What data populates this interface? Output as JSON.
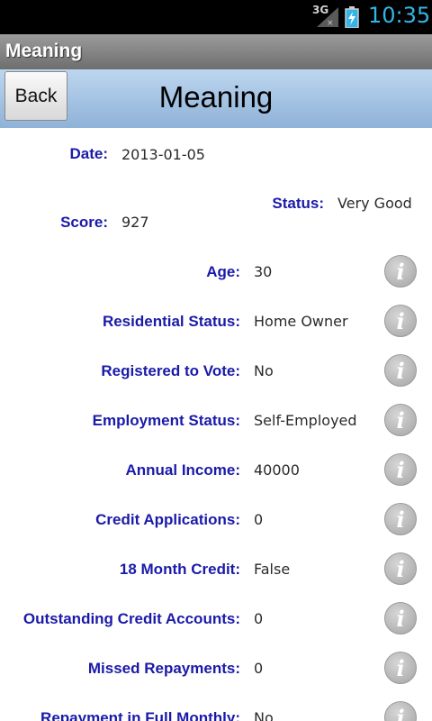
{
  "statusbar": {
    "network": "3G",
    "time": "10:35"
  },
  "titlebar": {
    "title": "Meaning"
  },
  "header": {
    "back_label": "Back",
    "title": "Meaning"
  },
  "summary": {
    "date_label": "Date:",
    "date_value": "2013-01-05",
    "status_label": "Status:",
    "status_value": "Very Good",
    "score_label": "Score:",
    "score_value": "927"
  },
  "rows": [
    {
      "label": "Age:",
      "value": "30"
    },
    {
      "label": "Residential Status:",
      "value": "Home Owner"
    },
    {
      "label": "Registered to Vote:",
      "value": "No"
    },
    {
      "label": "Employment Status:",
      "value": "Self-Employed"
    },
    {
      "label": "Annual Income:",
      "value": "40000"
    },
    {
      "label": "Credit Applications:",
      "value": "0"
    },
    {
      "label": "18 Month Credit:",
      "value": "False"
    },
    {
      "label": "Outstanding Credit Accounts:",
      "value": "0"
    },
    {
      "label": "Missed Repayments:",
      "value": "0"
    },
    {
      "label": "Repayment in Full Monthly:",
      "value": "No"
    }
  ],
  "info_icon_glyph": "i",
  "colors": {
    "label": "#1a1aaa",
    "clock": "#34b5e5",
    "header": "#a8c6e6"
  }
}
